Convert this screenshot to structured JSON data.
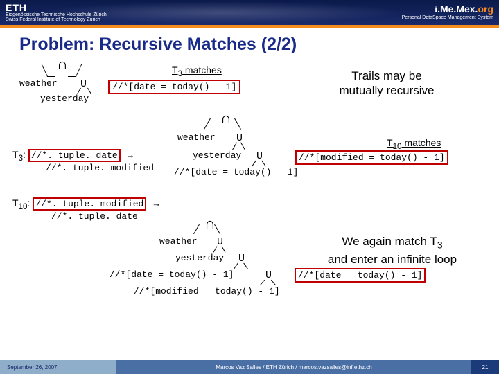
{
  "header": {
    "eth_top": "ETH",
    "eth_sub": "Eidgenössische Technische Hochschule Zürich",
    "eth_sub2": "Swiss Federal Institute of Technology Zurich",
    "imemex": "i.Me.Mex.",
    "imemex_org": "org",
    "imemex_sub": "Personal DataSpace Management System"
  },
  "title": "Problem: Recursive Matches (2/2)",
  "labels": {
    "cap": "∩",
    "union": "U",
    "t3_matches": "T",
    "t3_sub": "3",
    "matches_word": " matches",
    "t10_matches": "T",
    "t10_sub": "10",
    "arrow": "→"
  },
  "tree1": {
    "weather": "weather",
    "yesterday": "yesterday",
    "expr": "//*[date = today() - 1]"
  },
  "annot1": "Trails may be",
  "annot1b": "mutually recursive",
  "t3": {
    "label": "T",
    "sub": "3",
    "rule1": "//*. tuple. date",
    "rule2": "//*. tuple. modified"
  },
  "t10": {
    "label": "T",
    "sub": "10",
    "rule1": "//*. tuple. modified",
    "rule2": "//*. tuple. date"
  },
  "tree2": {
    "weather": "weather",
    "yesterday": "yesterday",
    "date_expr": "//*[date = today() - 1]",
    "mod_expr": "//*[modified = today() - 1]"
  },
  "tree3": {
    "weather": "weather",
    "yesterday": "yesterday",
    "date_expr": "//*[date = today() - 1]",
    "mod_expr": "//*[modified = today() - 1]",
    "date_expr2": "//*[date = today() - 1]"
  },
  "annot2a": "We again match T",
  "annot2a_sub": "3",
  "annot2b": "and enter an infinite loop",
  "footer": {
    "date": "September 26, 2007",
    "center": "Marcos Vaz Salles / ETH Zürich / marcos.vazsalles@inf.ethz.ch",
    "page": "21"
  }
}
